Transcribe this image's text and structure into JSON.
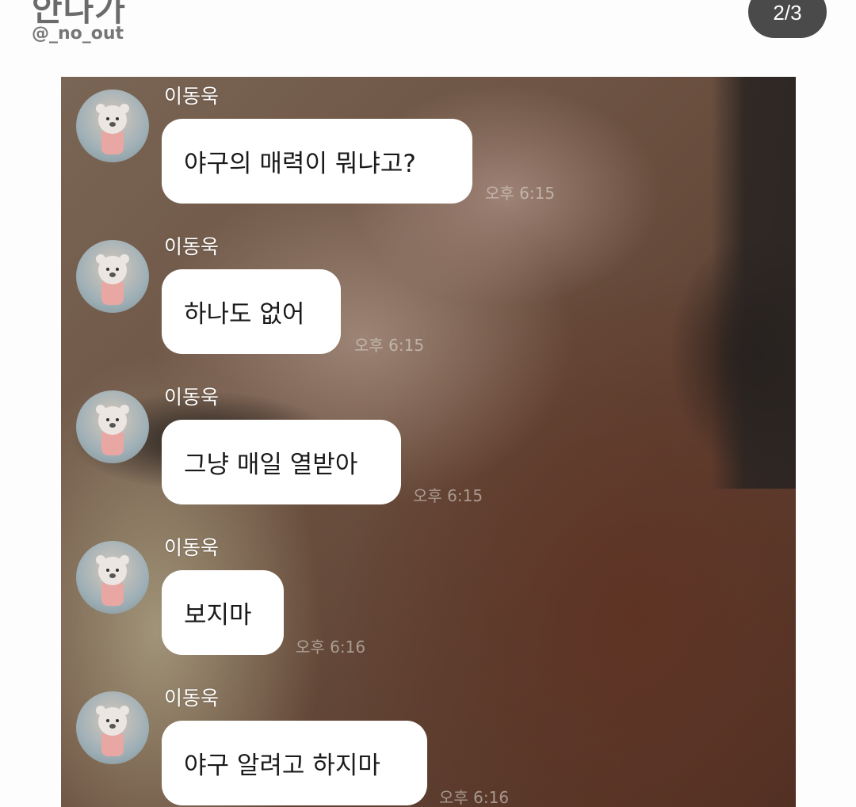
{
  "header": {
    "brand_title": "안나가",
    "handle": "@_no_out",
    "page_counter": "2/3"
  },
  "chat": {
    "messages": [
      {
        "sender": "이동욱",
        "text": "야구의 매력이 뭐냐고?",
        "time": "오후 6:15"
      },
      {
        "sender": "이동욱",
        "text": "하나도 없어",
        "time": "오후 6:15"
      },
      {
        "sender": "이동욱",
        "text": "그냥 매일 열받아",
        "time": "오후 6:15"
      },
      {
        "sender": "이동욱",
        "text": "보지마",
        "time": "오후 6:16"
      },
      {
        "sender": "이동욱",
        "text": "야구 알려고 하지마",
        "time": "오후 6:16"
      }
    ]
  },
  "colors": {
    "counter_bg": "#4a4a4a",
    "bubble_bg": "#ffffff"
  },
  "icons": {
    "avatar": "bear-plush-avatar"
  }
}
